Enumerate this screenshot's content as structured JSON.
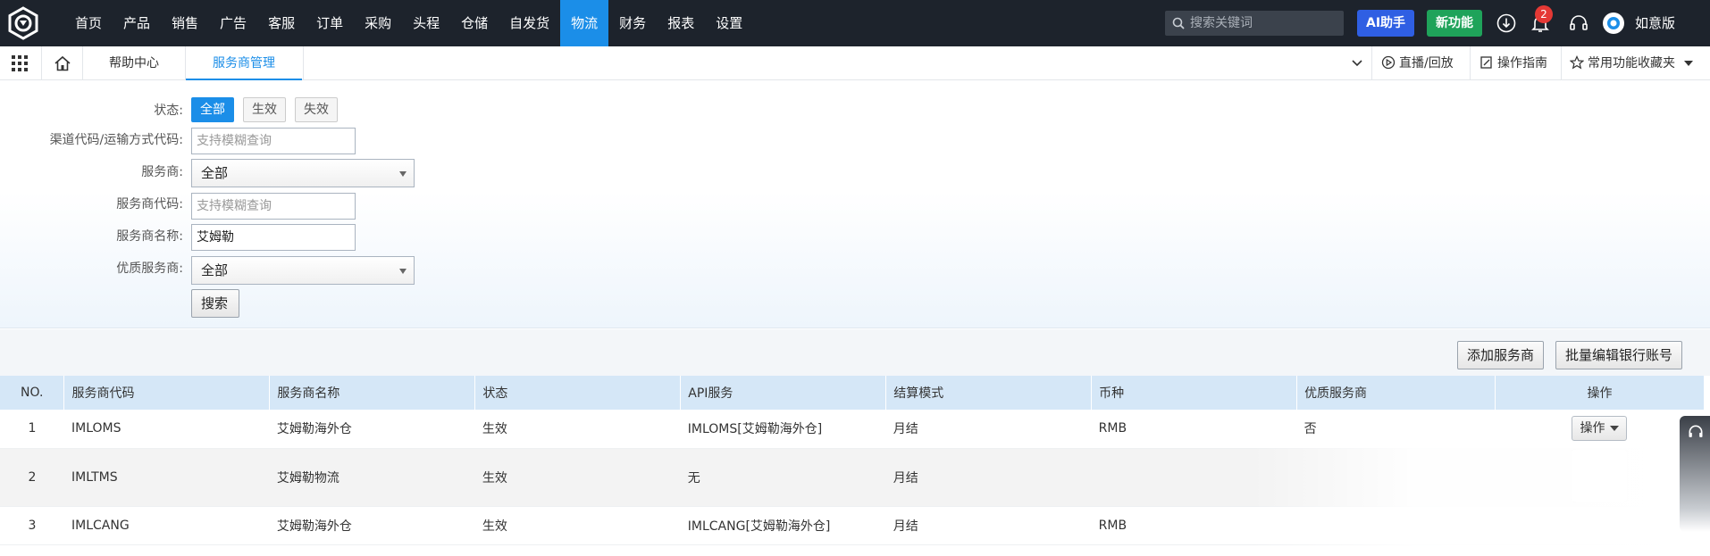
{
  "topnav": {
    "items": [
      "首页",
      "产品",
      "销售",
      "广告",
      "客服",
      "订单",
      "采购",
      "头程",
      "仓储",
      "自发货",
      "物流",
      "财务",
      "报表",
      "设置"
    ],
    "active_index": 10,
    "search_placeholder": "搜索关键词",
    "ai_label": "AI助手",
    "new_label": "新功能",
    "notification_count": "2",
    "user_name": "如意版",
    "colors": {
      "bar": "#1d232c",
      "active": "#1b8ee8",
      "ai": "#2f5fe3",
      "new": "#1fa35a",
      "badge": "#e53935"
    }
  },
  "tabbar": {
    "tabs": [
      "帮助中心",
      "服务商管理"
    ],
    "active_index": 1,
    "live_label": "直播/回放",
    "guide_label": "操作指南",
    "favorites_label": "常用功能收藏夹"
  },
  "filter": {
    "status_label": "状态:",
    "status_options": [
      "全部",
      "生效",
      "失效"
    ],
    "status_selected": "全部",
    "channel_label": "渠道代码/运输方式代码:",
    "channel_placeholder": "支持模糊查询",
    "provider_label": "服务商:",
    "provider_value": "全部",
    "provider_code_label": "服务商代码:",
    "provider_code_placeholder": "支持模糊查询",
    "provider_name_label": "服务商名称:",
    "provider_name_value": "艾姆勒",
    "premium_label": "优质服务商:",
    "premium_value": "全部",
    "search_button": "搜索"
  },
  "actions": {
    "add_provider": "添加服务商",
    "batch_edit_bank": "批量编辑银行账号"
  },
  "table": {
    "headers": [
      "NO.",
      "服务商代码",
      "服务商名称",
      "状态",
      "API服务",
      "结算模式",
      "币种",
      "优质服务商",
      "操作"
    ],
    "rows": [
      [
        "1",
        "IMLOMS",
        "艾姆勒海外仓",
        "生效",
        "IMLOMS[艾姆勒海外仓]",
        "月结",
        "RMB",
        "否",
        "操作"
      ],
      [
        "2",
        "IMLTMS",
        "艾姆勒物流",
        "生效",
        "无",
        "月结",
        "",
        "",
        ""
      ],
      [
        "3",
        "IMLCANG",
        "艾姆勒海外仓",
        "生效",
        "IMLCANG[艾姆勒海外仓]",
        "月结",
        "RMB",
        "",
        ""
      ]
    ]
  }
}
